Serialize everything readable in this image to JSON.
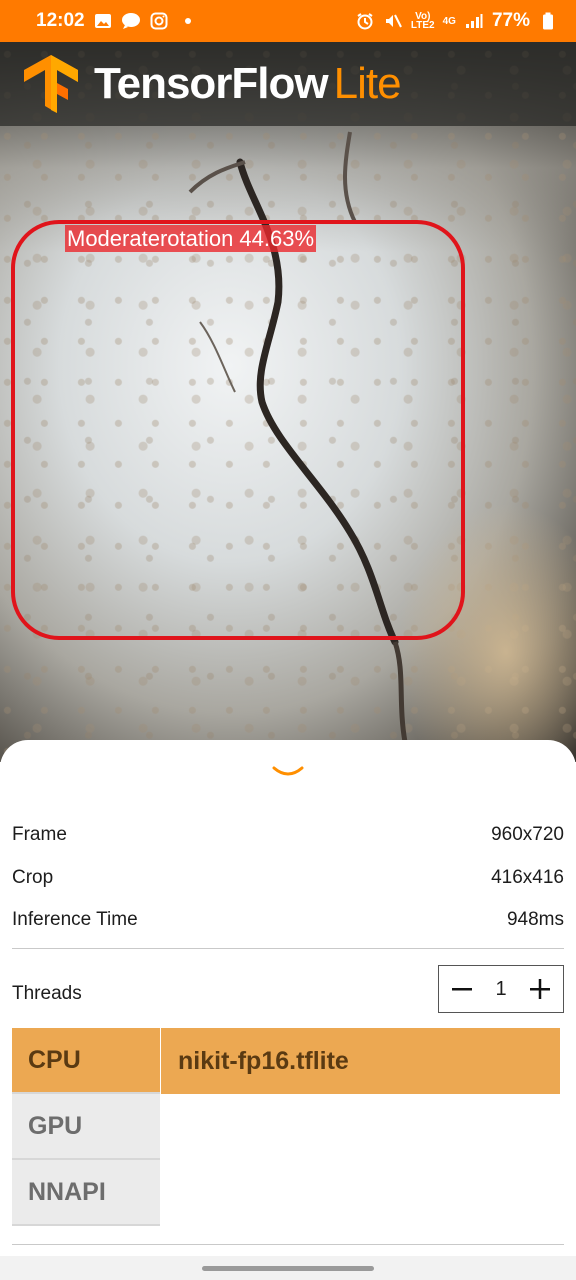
{
  "status_bar": {
    "time": "12:02",
    "network_top": "Vo)",
    "network_bottom": "LTE2",
    "network_type": "4G",
    "battery": "77%",
    "icons": [
      "gallery-icon",
      "chat-icon",
      "instagram-icon",
      "alarm-icon",
      "mute-icon",
      "signal-icon",
      "battery-icon"
    ]
  },
  "header": {
    "brand_main": "TensorFlow",
    "brand_accent": "Lite",
    "accent_color": "#ff8f00"
  },
  "detection": {
    "label": "Moderaterotation 44.63%",
    "box_color": "#e0141b"
  },
  "sheet": {
    "frame_label": "Frame",
    "frame_value": "960x720",
    "crop_label": "Crop",
    "crop_value": "416x416",
    "inference_label": "Inference Time",
    "inference_value": "948ms",
    "threads_label": "Threads",
    "threads_value": "1",
    "delegates": [
      "CPU",
      "GPU",
      "NNAPI"
    ],
    "selected_delegate": "CPU",
    "models": [
      "nikit-fp16.tflite"
    ],
    "selected_model": "nikit-fp16.tflite"
  },
  "colors": {
    "status_bar": "#ff7a00",
    "selected": "#eca852"
  }
}
